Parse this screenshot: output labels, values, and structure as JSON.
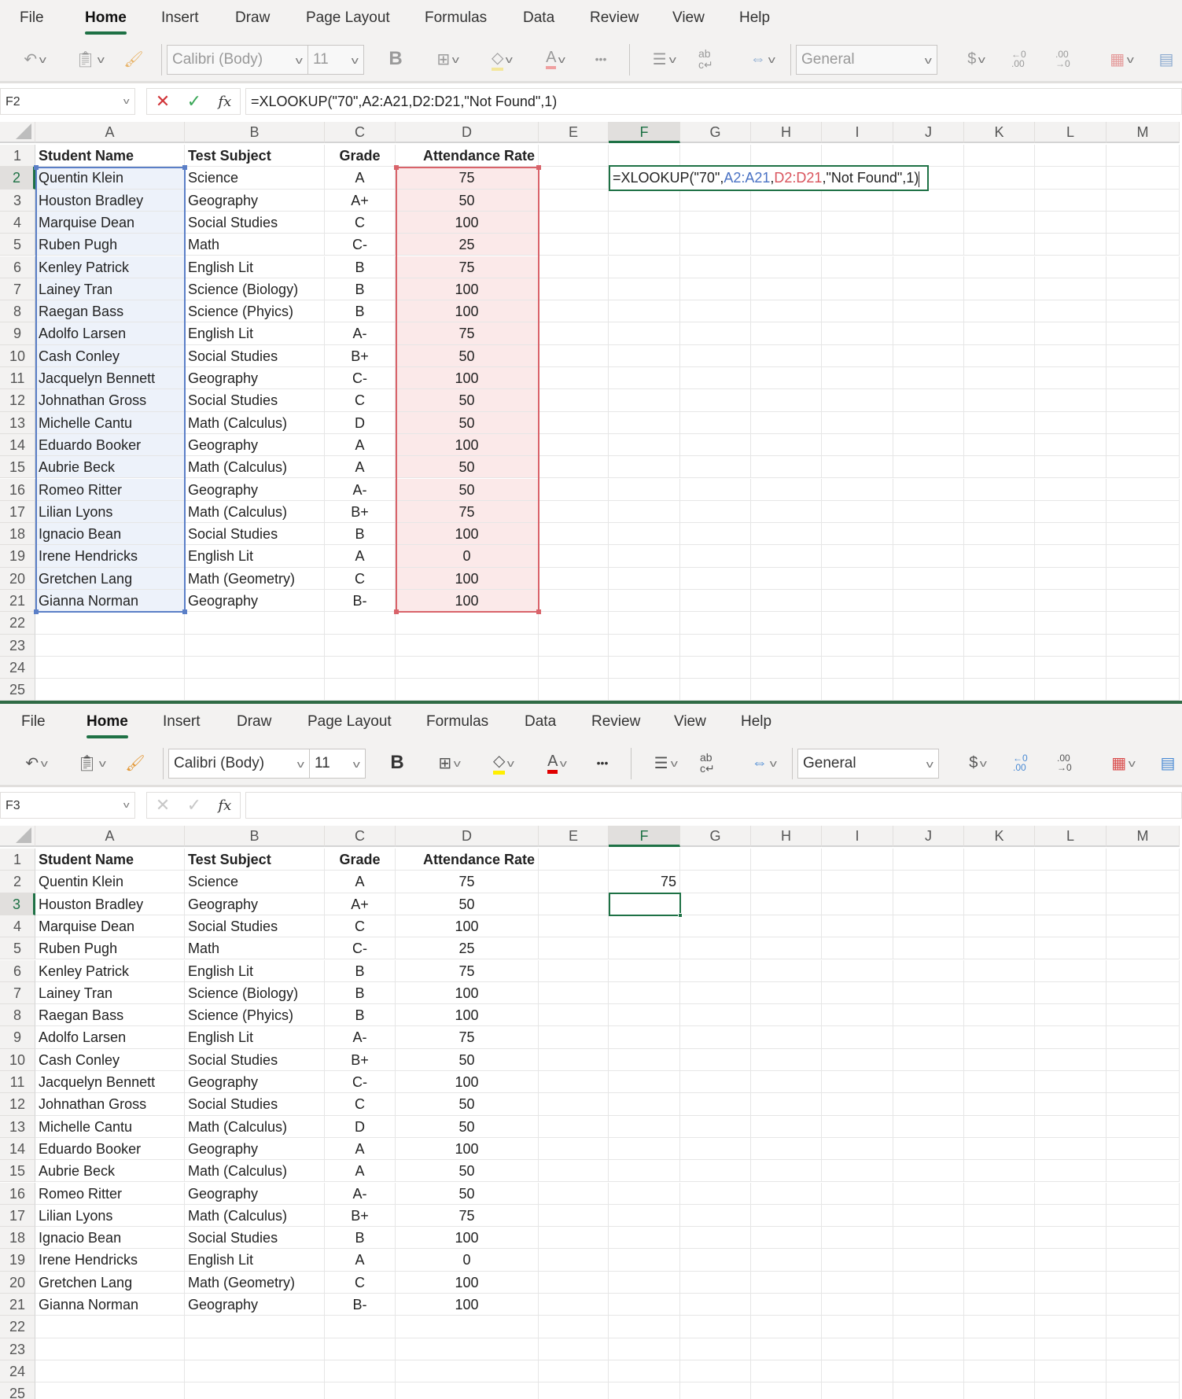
{
  "ribbon": {
    "tabs": [
      "File",
      "Home",
      "Insert",
      "Draw",
      "Page Layout",
      "Formulas",
      "Data",
      "Review",
      "View",
      "Help"
    ],
    "active_tab": "Home",
    "font_name": "Calibri (Body)",
    "font_size": "11",
    "number_format": "General",
    "bold_label": "B",
    "font_color_label": "A",
    "more_label": "•••",
    "currency_label": "$",
    "increase_decimal_label": "←0 .00",
    "decrease_decimal_label": ".00 →0",
    "wrap_label": "ab c↵"
  },
  "colors": {
    "accent_green": "#1e7145",
    "range_blue": "#5b7fc7",
    "range_red": "#d9636a",
    "fill_highlight": "#ffef00",
    "font_color": "#e00000"
  },
  "columns": [
    "A",
    "B",
    "C",
    "D",
    "E",
    "F",
    "G",
    "H",
    "I",
    "J",
    "K",
    "L",
    "M"
  ],
  "rows": [
    "1",
    "2",
    "3",
    "4",
    "5",
    "6",
    "7",
    "8",
    "9",
    "10",
    "11",
    "12",
    "13",
    "14",
    "15",
    "16",
    "17",
    "18",
    "19",
    "20",
    "21",
    "22",
    "23",
    "24",
    "25"
  ],
  "table": {
    "headers": [
      "Student Name",
      "Test Subject",
      "Grade",
      "Attendance Rate"
    ],
    "data": [
      [
        "Quentin Klein",
        "Science",
        "A",
        "75"
      ],
      [
        "Houston Bradley",
        "Geography",
        "A+",
        "50"
      ],
      [
        "Marquise Dean",
        "Social Studies",
        "C",
        "100"
      ],
      [
        "Ruben Pugh",
        "Math",
        "C-",
        "25"
      ],
      [
        "Kenley Patrick",
        "English Lit",
        "B",
        "75"
      ],
      [
        "Lainey Tran",
        "Science (Biology)",
        "B",
        "100"
      ],
      [
        "Raegan Bass",
        "Science (Phyics)",
        "B",
        "100"
      ],
      [
        "Adolfo Larsen",
        "English Lit",
        "A-",
        "75"
      ],
      [
        "Cash Conley",
        "Social Studies",
        "B+",
        "50"
      ],
      [
        "Jacquelyn Bennett",
        "Geography",
        "C-",
        "100"
      ],
      [
        "Johnathan Gross",
        "Social Studies",
        "C",
        "50"
      ],
      [
        "Michelle Cantu",
        "Math (Calculus)",
        "D",
        "50"
      ],
      [
        "Eduardo Booker",
        "Geography",
        "A",
        "100"
      ],
      [
        "Aubrie Beck",
        "Math (Calculus)",
        "A",
        "50"
      ],
      [
        "Romeo Ritter",
        "Geography",
        "A-",
        "50"
      ],
      [
        "Lilian Lyons",
        "Math (Calculus)",
        "B+",
        "75"
      ],
      [
        "Ignacio Bean",
        "Social Studies",
        "B",
        "100"
      ],
      [
        "Irene Hendricks",
        "English Lit",
        "A",
        "0"
      ],
      [
        "Gretchen Lang",
        "Math (Geometry)",
        "C",
        "100"
      ],
      [
        "Gianna Norman",
        "Geography",
        "B-",
        "100"
      ]
    ]
  },
  "top": {
    "name_box": "F2",
    "formula": "=XLOOKUP(\"70\",A2:A21,D2:D21,\"Not Found\",1)",
    "selected_column": "F",
    "selected_row": "2",
    "edit_parts": {
      "p1": "=XLOOKUP(\"70\",",
      "ref1": "A2:A21",
      "comma": ",",
      "ref2": "D2:D21",
      "p2": ",\"Not Found\",1)"
    }
  },
  "bottom": {
    "name_box": "F3",
    "formula": "",
    "selected_column": "F",
    "selected_row": "3",
    "result_cell": "F2",
    "result_value": "75"
  }
}
